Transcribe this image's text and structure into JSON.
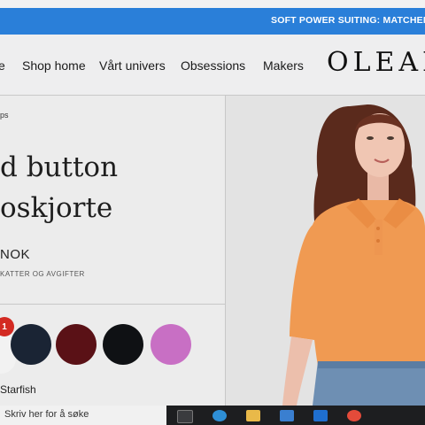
{
  "promo": {
    "text": "SOFT POWER SUITING: MATCHENDE"
  },
  "nav": {
    "items": [
      "e",
      "Shop home",
      "Vårt univers",
      "Obsessions",
      "Makers"
    ],
    "logo": "OLEAN"
  },
  "product": {
    "breadcrumb": "ps",
    "title_line1": "d button",
    "title_line2": "oskjorte",
    "price": "NOK",
    "tax_note": "KATTER OG AVGIFTER",
    "swatch_badge": "1",
    "color_name": "Starfish",
    "swatches": [
      "#f2f2f2",
      "#1a2434",
      "#5a1116",
      "#0f1114",
      "#c86fc4"
    ]
  },
  "taskbar": {
    "search_placeholder": "Skriv her for å søke"
  },
  "colors": {
    "promo_bar": "#2a7fd9",
    "shirt": "#f09a52",
    "badge": "#d32a22"
  }
}
